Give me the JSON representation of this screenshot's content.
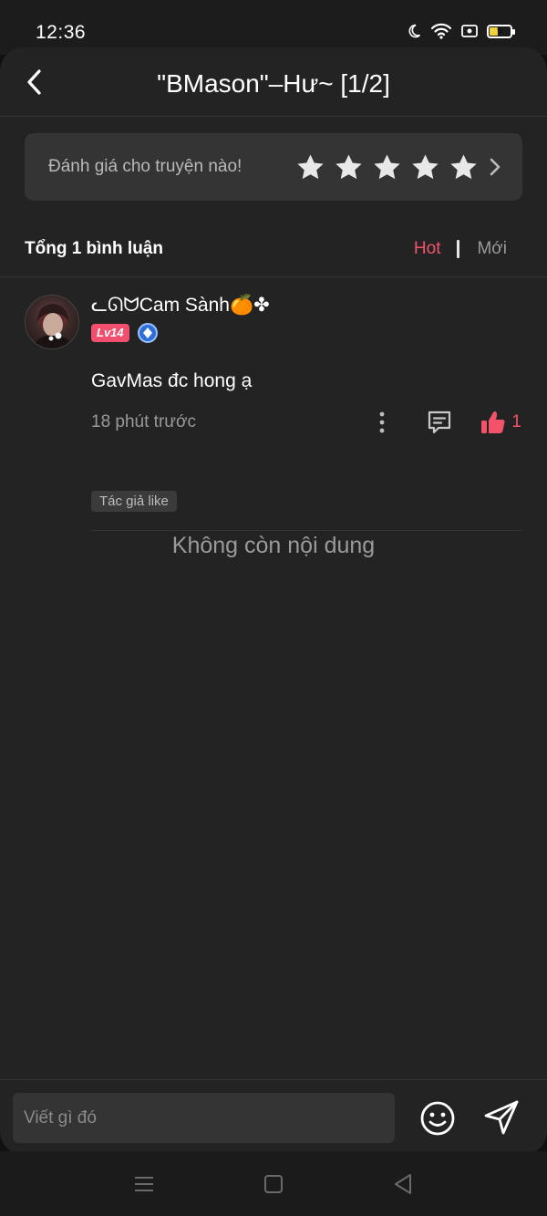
{
  "status_bar": {
    "time": "12:36",
    "battery_level": "9",
    "icons": [
      "moon-icon",
      "wifi-icon",
      "screen-record-icon",
      "battery-icon"
    ]
  },
  "header": {
    "title": "\"BMason\"–Hư~ [1/2]",
    "back_icon": "chevron-left-icon"
  },
  "rating": {
    "label": "Đánh giá cho truyện nào!",
    "stars_selected": 0,
    "stars_total": 5,
    "star_color": "#e8e8e8"
  },
  "summary": {
    "total_label": "Tổng 1 bình luận",
    "sort_hot": "Hot",
    "sort_new": "Mới",
    "active_sort": "Hot",
    "accent_color": "#f2536b"
  },
  "comments": [
    {
      "username": "ᓚᘏᗢCam Sành🍊✤",
      "level": "Lv14",
      "text": "GavMas đc hong ạ",
      "time": "18 phút trước",
      "likes": "1",
      "author_tag": "Tác giả like"
    }
  ],
  "empty_note": "Không còn nội dung",
  "input": {
    "placeholder": "Viết gì đó"
  }
}
